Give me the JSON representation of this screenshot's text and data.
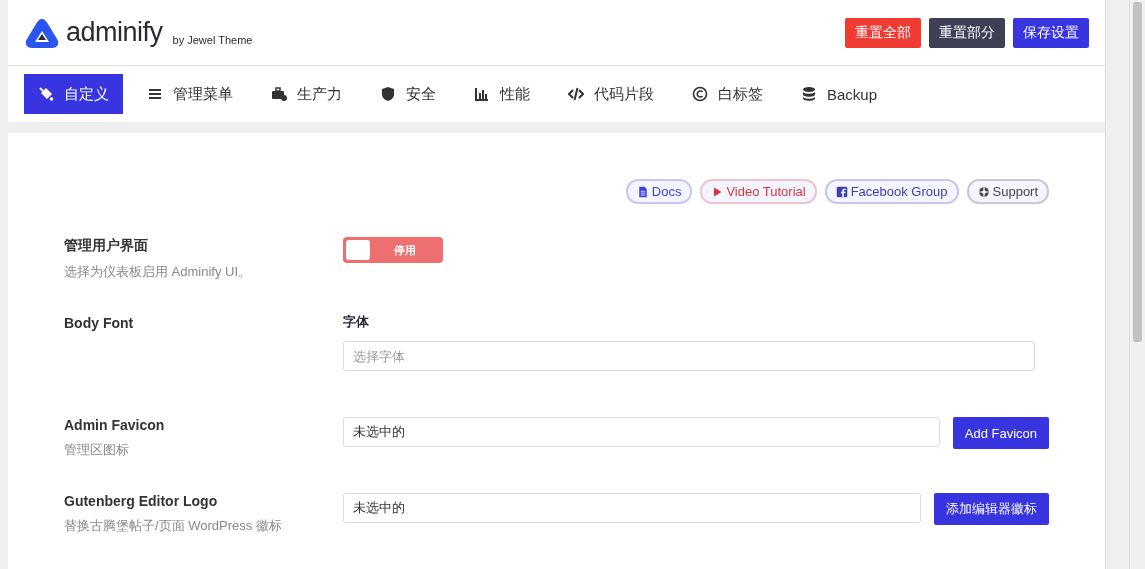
{
  "brand": {
    "name": "adminify",
    "byline": "by Jewel Theme"
  },
  "header_buttons": [
    {
      "label": "重置全部",
      "kind": "danger"
    },
    {
      "label": "重置部分",
      "kind": "dark"
    },
    {
      "label": "保存设置",
      "kind": "primary"
    }
  ],
  "tabs": [
    {
      "label": "自定义",
      "kind": "paint",
      "selected": true
    },
    {
      "label": "管理菜单",
      "kind": "menu",
      "selected": false
    },
    {
      "label": "生产力",
      "kind": "toolbox",
      "selected": false
    },
    {
      "label": "安全",
      "kind": "shield",
      "selected": false
    },
    {
      "label": "性能",
      "kind": "chart",
      "selected": false
    },
    {
      "label": "代码片段",
      "kind": "code",
      "selected": false
    },
    {
      "label": "白标签",
      "kind": "copyright",
      "selected": false
    },
    {
      "label": "Backup",
      "kind": "database",
      "selected": false
    }
  ],
  "help_links": [
    {
      "label": "Docs",
      "kind": "doc",
      "color": "#3b3fe0"
    },
    {
      "label": "Video Tutorial",
      "kind": "play",
      "color": "#e0343c"
    },
    {
      "label": "Facebook Group",
      "kind": "facebook",
      "color": "#3b3fb0"
    },
    {
      "label": "Support",
      "kind": "lifering",
      "color": "#444450"
    }
  ],
  "settings": [
    {
      "kind": "toggle",
      "title": "管理用户界面",
      "description": "选择为仪表板启用 Adminify UI。",
      "on": false,
      "state_label": "停用"
    },
    {
      "kind": "select",
      "title": "Body Font",
      "field_label": "字体",
      "placeholder": "选择字体"
    },
    {
      "kind": "media",
      "title": "Admin Favicon",
      "description": "管理区图标",
      "value": "未选中的",
      "button": "Add Favicon"
    },
    {
      "kind": "media",
      "title": "Gutenberg Editor Logo",
      "description": "替换古腾堡帖子/页面 WordPress 徽标",
      "value": "未选中的",
      "button": "添加编辑器徽标"
    }
  ]
}
